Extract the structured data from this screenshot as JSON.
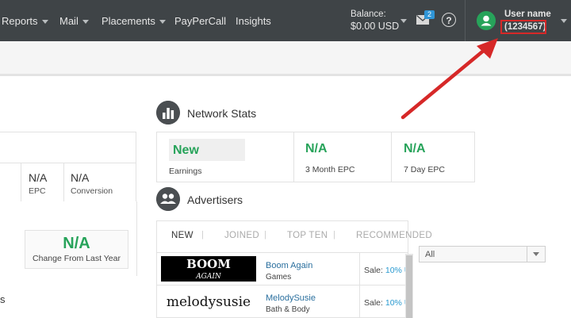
{
  "topnav": {
    "items": [
      {
        "label": "Reports",
        "has_caret": true
      },
      {
        "label": "Mail",
        "has_caret": true
      },
      {
        "label": "Placements",
        "has_caret": true
      },
      {
        "label": "PayPerCall",
        "has_caret": false
      },
      {
        "label": "Insights",
        "has_caret": false
      }
    ],
    "balance_label": "Balance:",
    "balance_value": "$0.00 USD",
    "mail_badge": "2",
    "help_glyph": "?",
    "user_name": "User name",
    "user_id": "(1234567)",
    "icons": {
      "mail": "envelope-icon",
      "help": "question-circle-icon",
      "avatar": "user-avatar-icon"
    }
  },
  "left_panel": {
    "stats": [
      {
        "value": "N/A",
        "label": "EPC"
      },
      {
        "value": "N/A",
        "label": "Conversion"
      }
    ],
    "change_value": "N/A",
    "change_label": "Change From Last Year",
    "cut_text": "s"
  },
  "network_stats": {
    "title": "Network Stats",
    "icon": "bar-chart-icon",
    "cells": [
      {
        "value": "New",
        "label": "Earnings"
      },
      {
        "value": "N/A",
        "label": "3 Month EPC"
      },
      {
        "value": "N/A",
        "label": "7 Day EPC"
      }
    ]
  },
  "advertisers": {
    "title": "Advertisers",
    "icon": "users-icon",
    "tabs": [
      {
        "label": "NEW",
        "active": true
      },
      {
        "label": "JOINED",
        "active": false
      },
      {
        "label": "TOP TEN",
        "active": false
      },
      {
        "label": "RECOMMENDED",
        "active": false
      }
    ],
    "filter_selected": "All",
    "rows": [
      {
        "logo_line1": "BOOM",
        "logo_line2": "AGAIN",
        "name": "Boom Again",
        "category": "Games",
        "sale_prefix": "Sale: ",
        "sale_pct": "10% U"
      },
      {
        "logo_line1": "melodysusie",
        "logo_line2": "",
        "name": "MelodySusie",
        "category": "Bath & Body",
        "sale_prefix": "Sale: ",
        "sale_pct": "10% U"
      }
    ]
  },
  "colors": {
    "nav_bg": "#3f4447",
    "green": "#27a35a",
    "link": "#2a6f9e",
    "annotation_red": "#d62828"
  }
}
